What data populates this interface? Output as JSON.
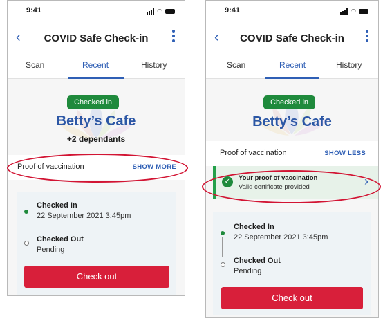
{
  "colors": {
    "primary_blue": "#2f5fb5",
    "checked_in_green": "#1f8a3c",
    "checkout_red": "#d81f3a",
    "annotation_red": "#d21433"
  },
  "left": {
    "status_time": "9:41",
    "header": {
      "title": "COVID Safe Check-in",
      "back_icon": "chevron-left-icon",
      "more_icon": "more-vertical-icon"
    },
    "tabs": [
      {
        "label": "Scan"
      },
      {
        "label": "Recent"
      },
      {
        "label": "History"
      }
    ],
    "active_tab": "Recent",
    "badge": "Checked in",
    "venue": "Betty’s Cafe",
    "dependants": "+2 dependants",
    "proof": {
      "label": "Proof of vaccination",
      "toggle": "SHOW MORE"
    },
    "timeline": [
      {
        "title": "Checked In",
        "sub": "22 September 2021 3:45pm"
      },
      {
        "title": "Checked Out",
        "sub": "Pending"
      }
    ],
    "checkout_button": "Check out"
  },
  "right": {
    "status_time": "9:41",
    "header": {
      "title": "COVID Safe Check-in",
      "back_icon": "chevron-left-icon",
      "more_icon": "more-vertical-icon"
    },
    "tabs": [
      {
        "label": "Scan"
      },
      {
        "label": "Recent"
      },
      {
        "label": "History"
      }
    ],
    "active_tab": "Recent",
    "badge": "Checked in",
    "venue": "Betty’s Cafe",
    "proof": {
      "label": "Proof of vaccination",
      "toggle": "SHOW LESS"
    },
    "proof_banner": {
      "title": "Your proof of vaccination",
      "subtitle": "Valid certificate provided",
      "icon": "check-circle-icon"
    },
    "timeline": [
      {
        "title": "Checked In",
        "sub": "22 September 2021 3:45pm"
      },
      {
        "title": "Checked Out",
        "sub": "Pending"
      }
    ],
    "checkout_button": "Check out"
  }
}
